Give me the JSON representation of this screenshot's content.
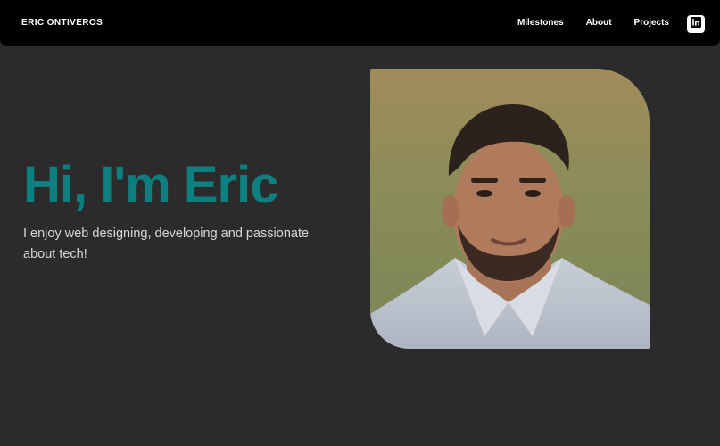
{
  "header": {
    "brand": "ERIC ONTIVEROS",
    "nav": [
      {
        "label": "Milestones"
      },
      {
        "label": "About"
      },
      {
        "label": "Projects"
      }
    ],
    "linkedin_icon_label": "in"
  },
  "hero": {
    "title": "Hi, I'm Eric",
    "subtitle": "I enjoy web designing, developing and passionate about tech!"
  },
  "colors": {
    "accent": "#0e7f80",
    "background": "#2b2b2b",
    "navbar": "#000000"
  }
}
